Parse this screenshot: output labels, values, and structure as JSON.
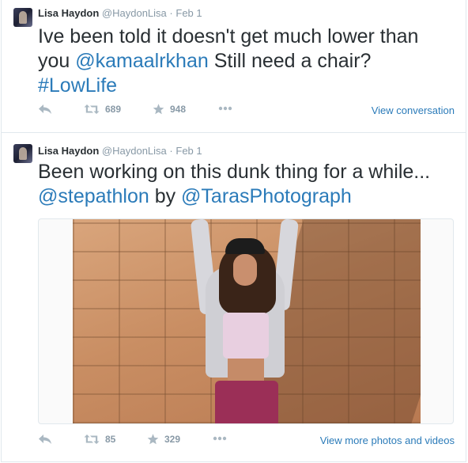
{
  "tweets": [
    {
      "name": "Lisa Haydon",
      "handle": "@HaydonLisa",
      "dot": "·",
      "date": "Feb 1",
      "text": {
        "part1": "Ive been told it doesn't get much lower than you ",
        "mention1": "@kamaalrkhan",
        "part2": "   Still need a chair? ",
        "hashtag": "#LowLife"
      },
      "retweets": "689",
      "favorites": "948",
      "right_link": "View conversation"
    },
    {
      "name": "Lisa Haydon",
      "handle": "@HaydonLisa",
      "dot": "·",
      "date": "Feb 1",
      "text": {
        "part1": "Been working on this dunk thing for a while... ",
        "mention1": "@stepathlon",
        "part2": " by ",
        "mention2": "@TarasPhotograph"
      },
      "retweets": "85",
      "favorites": "329",
      "right_link": "View more photos and videos"
    }
  ],
  "icons": {
    "reply": "reply-icon",
    "retweet": "retweet-icon",
    "favorite": "star-icon",
    "more": "more-icon"
  },
  "colors": {
    "link": "#2b7bb9",
    "text": "#292f33",
    "muted": "#8899a6",
    "border": "#e1e8ed"
  }
}
